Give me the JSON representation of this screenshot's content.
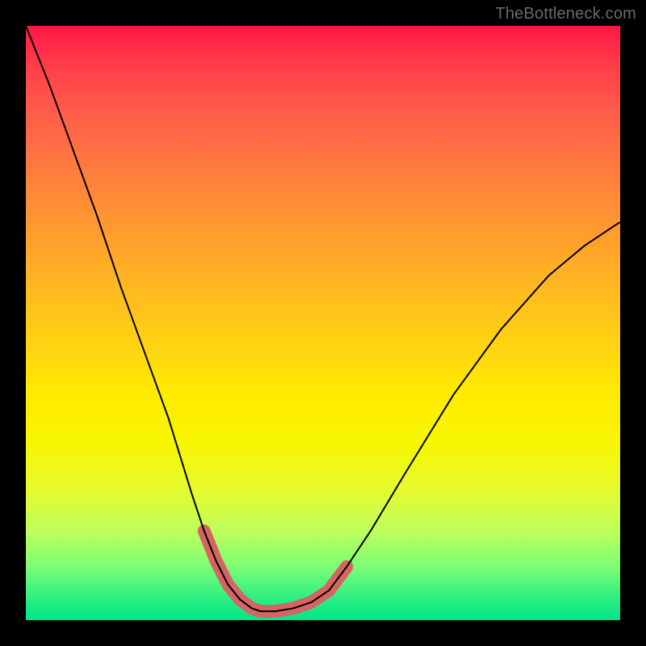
{
  "watermark": {
    "text": "TheBottleneck.com"
  },
  "chart_data": {
    "type": "line",
    "title": "",
    "xlabel": "",
    "ylabel": "",
    "xlim": [
      0,
      1
    ],
    "ylim": [
      0,
      1
    ],
    "grid": false,
    "legend": {
      "show": false
    },
    "series": [
      {
        "name": "curve",
        "color": "#000000",
        "width": 2,
        "x": [
          0.0,
          0.04,
          0.08,
          0.12,
          0.16,
          0.2,
          0.24,
          0.28,
          0.3,
          0.32,
          0.34,
          0.36,
          0.38,
          0.395,
          0.42,
          0.45,
          0.48,
          0.51,
          0.54,
          0.58,
          0.64,
          0.72,
          0.8,
          0.88,
          0.94,
          1.0
        ],
        "values": [
          1.0,
          0.9,
          0.79,
          0.68,
          0.56,
          0.45,
          0.34,
          0.21,
          0.15,
          0.1,
          0.06,
          0.035,
          0.02,
          0.015,
          0.015,
          0.02,
          0.03,
          0.05,
          0.09,
          0.15,
          0.25,
          0.38,
          0.49,
          0.58,
          0.63,
          0.67
        ]
      }
    ],
    "highlight": {
      "name": "bottom-highlight",
      "color": "#d56464",
      "width": 12,
      "linecap": "round",
      "x": [
        0.3,
        0.32,
        0.34,
        0.36,
        0.38,
        0.395,
        0.42,
        0.45,
        0.48,
        0.51,
        0.54
      ],
      "values": [
        0.15,
        0.1,
        0.06,
        0.035,
        0.02,
        0.015,
        0.015,
        0.02,
        0.03,
        0.05,
        0.09
      ]
    },
    "gradient_stops": [
      {
        "pos": 0.0,
        "color": "#ff1744"
      },
      {
        "pos": 0.3,
        "color": "#ff8a30"
      },
      {
        "pos": 0.6,
        "color": "#ffe400"
      },
      {
        "pos": 0.85,
        "color": "#beff5c"
      },
      {
        "pos": 1.0,
        "color": "#00e58a"
      }
    ]
  }
}
